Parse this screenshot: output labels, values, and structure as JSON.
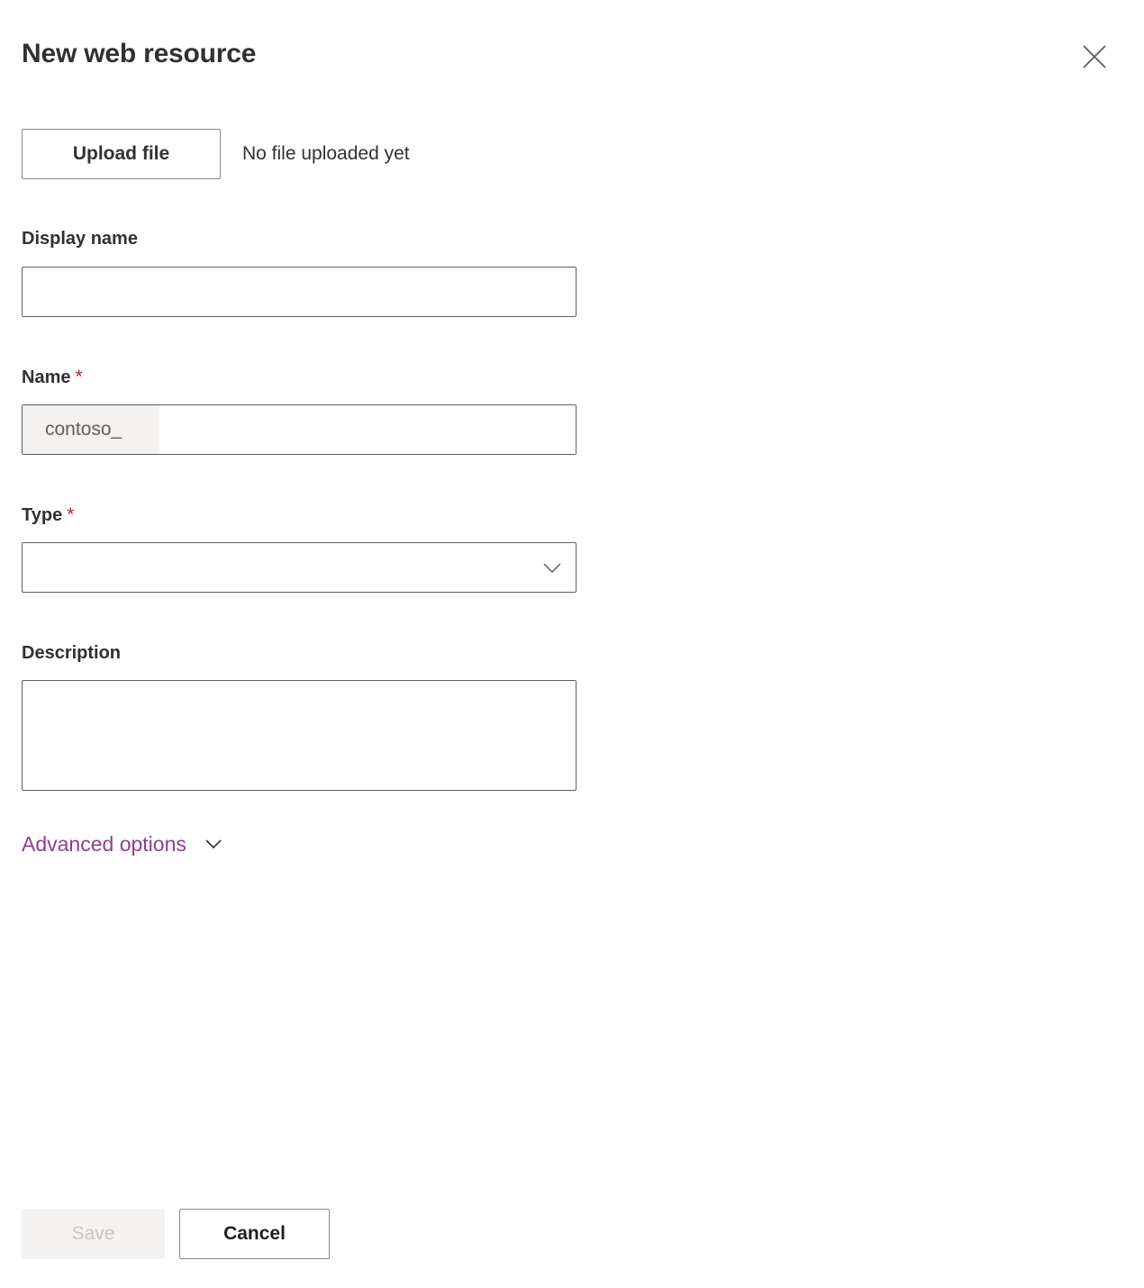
{
  "panel": {
    "title": "New web resource",
    "close_icon": "close-icon"
  },
  "upload": {
    "button_label": "Upload file",
    "status_text": "No file uploaded yet"
  },
  "fields": {
    "display_name": {
      "label": "Display name",
      "value": "",
      "placeholder": "",
      "required": false
    },
    "name": {
      "label": "Name",
      "required_marker": "*",
      "prefix": "contoso_",
      "value": "",
      "placeholder": "",
      "required": true
    },
    "type": {
      "label": "Type",
      "required_marker": "*",
      "value": "",
      "chevron_icon": "chevron-down-icon",
      "required": true
    },
    "description": {
      "label": "Description",
      "value": "",
      "placeholder": "",
      "required": false
    }
  },
  "advanced": {
    "label": "Advanced options",
    "chevron_icon": "chevron-down-icon",
    "expanded": false
  },
  "footer": {
    "save_label": "Save",
    "save_disabled": true,
    "cancel_label": "Cancel"
  },
  "colors": {
    "accent_link": "#8f3c96",
    "required_asterisk": "#a4262c",
    "text_primary": "#323130",
    "text_secondary": "#605e5c",
    "border": "#605e5c",
    "border_button": "#8a8886",
    "disabled_bg": "#f3f2f1",
    "disabled_text": "#c8c6c4",
    "background": "#ffffff"
  }
}
